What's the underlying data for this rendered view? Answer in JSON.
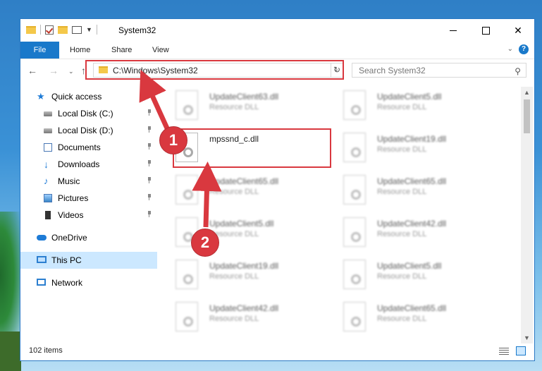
{
  "window": {
    "title": "System32",
    "controls": {
      "minimize": "",
      "maximize": "",
      "close": "✕"
    }
  },
  "ribbon": {
    "tabs": [
      "File",
      "Home",
      "Share",
      "View"
    ]
  },
  "address_bar": {
    "path": "C:\\Windows\\System32",
    "search_placeholder": "Search System32"
  },
  "sidebar": {
    "items": [
      {
        "label": "Quick access",
        "icon": "star-icon"
      },
      {
        "label": "Local Disk (C:)",
        "icon": "drive-icon",
        "pinned": true
      },
      {
        "label": "Local Disk (D:)",
        "icon": "drive-icon",
        "pinned": true
      },
      {
        "label": "Documents",
        "icon": "documents-icon",
        "pinned": true
      },
      {
        "label": "Downloads",
        "icon": "download-icon",
        "pinned": true
      },
      {
        "label": "Music",
        "icon": "music-icon",
        "pinned": true
      },
      {
        "label": "Pictures",
        "icon": "pictures-icon",
        "pinned": true
      },
      {
        "label": "Videos",
        "icon": "videos-icon",
        "pinned": true
      },
      {
        "label": "OneDrive",
        "icon": "cloud-icon"
      },
      {
        "label": "This PC",
        "icon": "computer-icon",
        "selected": true
      },
      {
        "label": "Network",
        "icon": "network-icon"
      }
    ]
  },
  "files": {
    "left": [
      {
        "name": "UpdateClient63.dll",
        "type": "Resource DLL"
      },
      {
        "name": "mpssnd_c.dll",
        "type": ""
      },
      {
        "name": "UpdateClient65.dll",
        "type": "Resource DLL"
      },
      {
        "name": "UpdateClient5.dll",
        "type": "Resource DLL"
      },
      {
        "name": "UpdateClient19.dll",
        "type": "Resource DLL"
      },
      {
        "name": "UpdateClient42.dll",
        "type": "Resource DLL"
      }
    ],
    "right": [
      {
        "name": "UpdateClient5.dll",
        "type": "Resource DLL"
      },
      {
        "name": "UpdateClient19.dll",
        "type": "Resource DLL"
      },
      {
        "name": "UpdateClient65.dll",
        "type": "Resource DLL"
      },
      {
        "name": "UpdateClient42.dll",
        "type": "Resource DLL"
      },
      {
        "name": "UpdateClient5.dll",
        "type": "Resource DLL"
      },
      {
        "name": "UpdateClient65.dll",
        "type": "Resource DLL"
      }
    ]
  },
  "status": {
    "item_count": "102 items"
  },
  "annotations": {
    "step1": "1",
    "step2": "2",
    "color": "#d9383f"
  }
}
